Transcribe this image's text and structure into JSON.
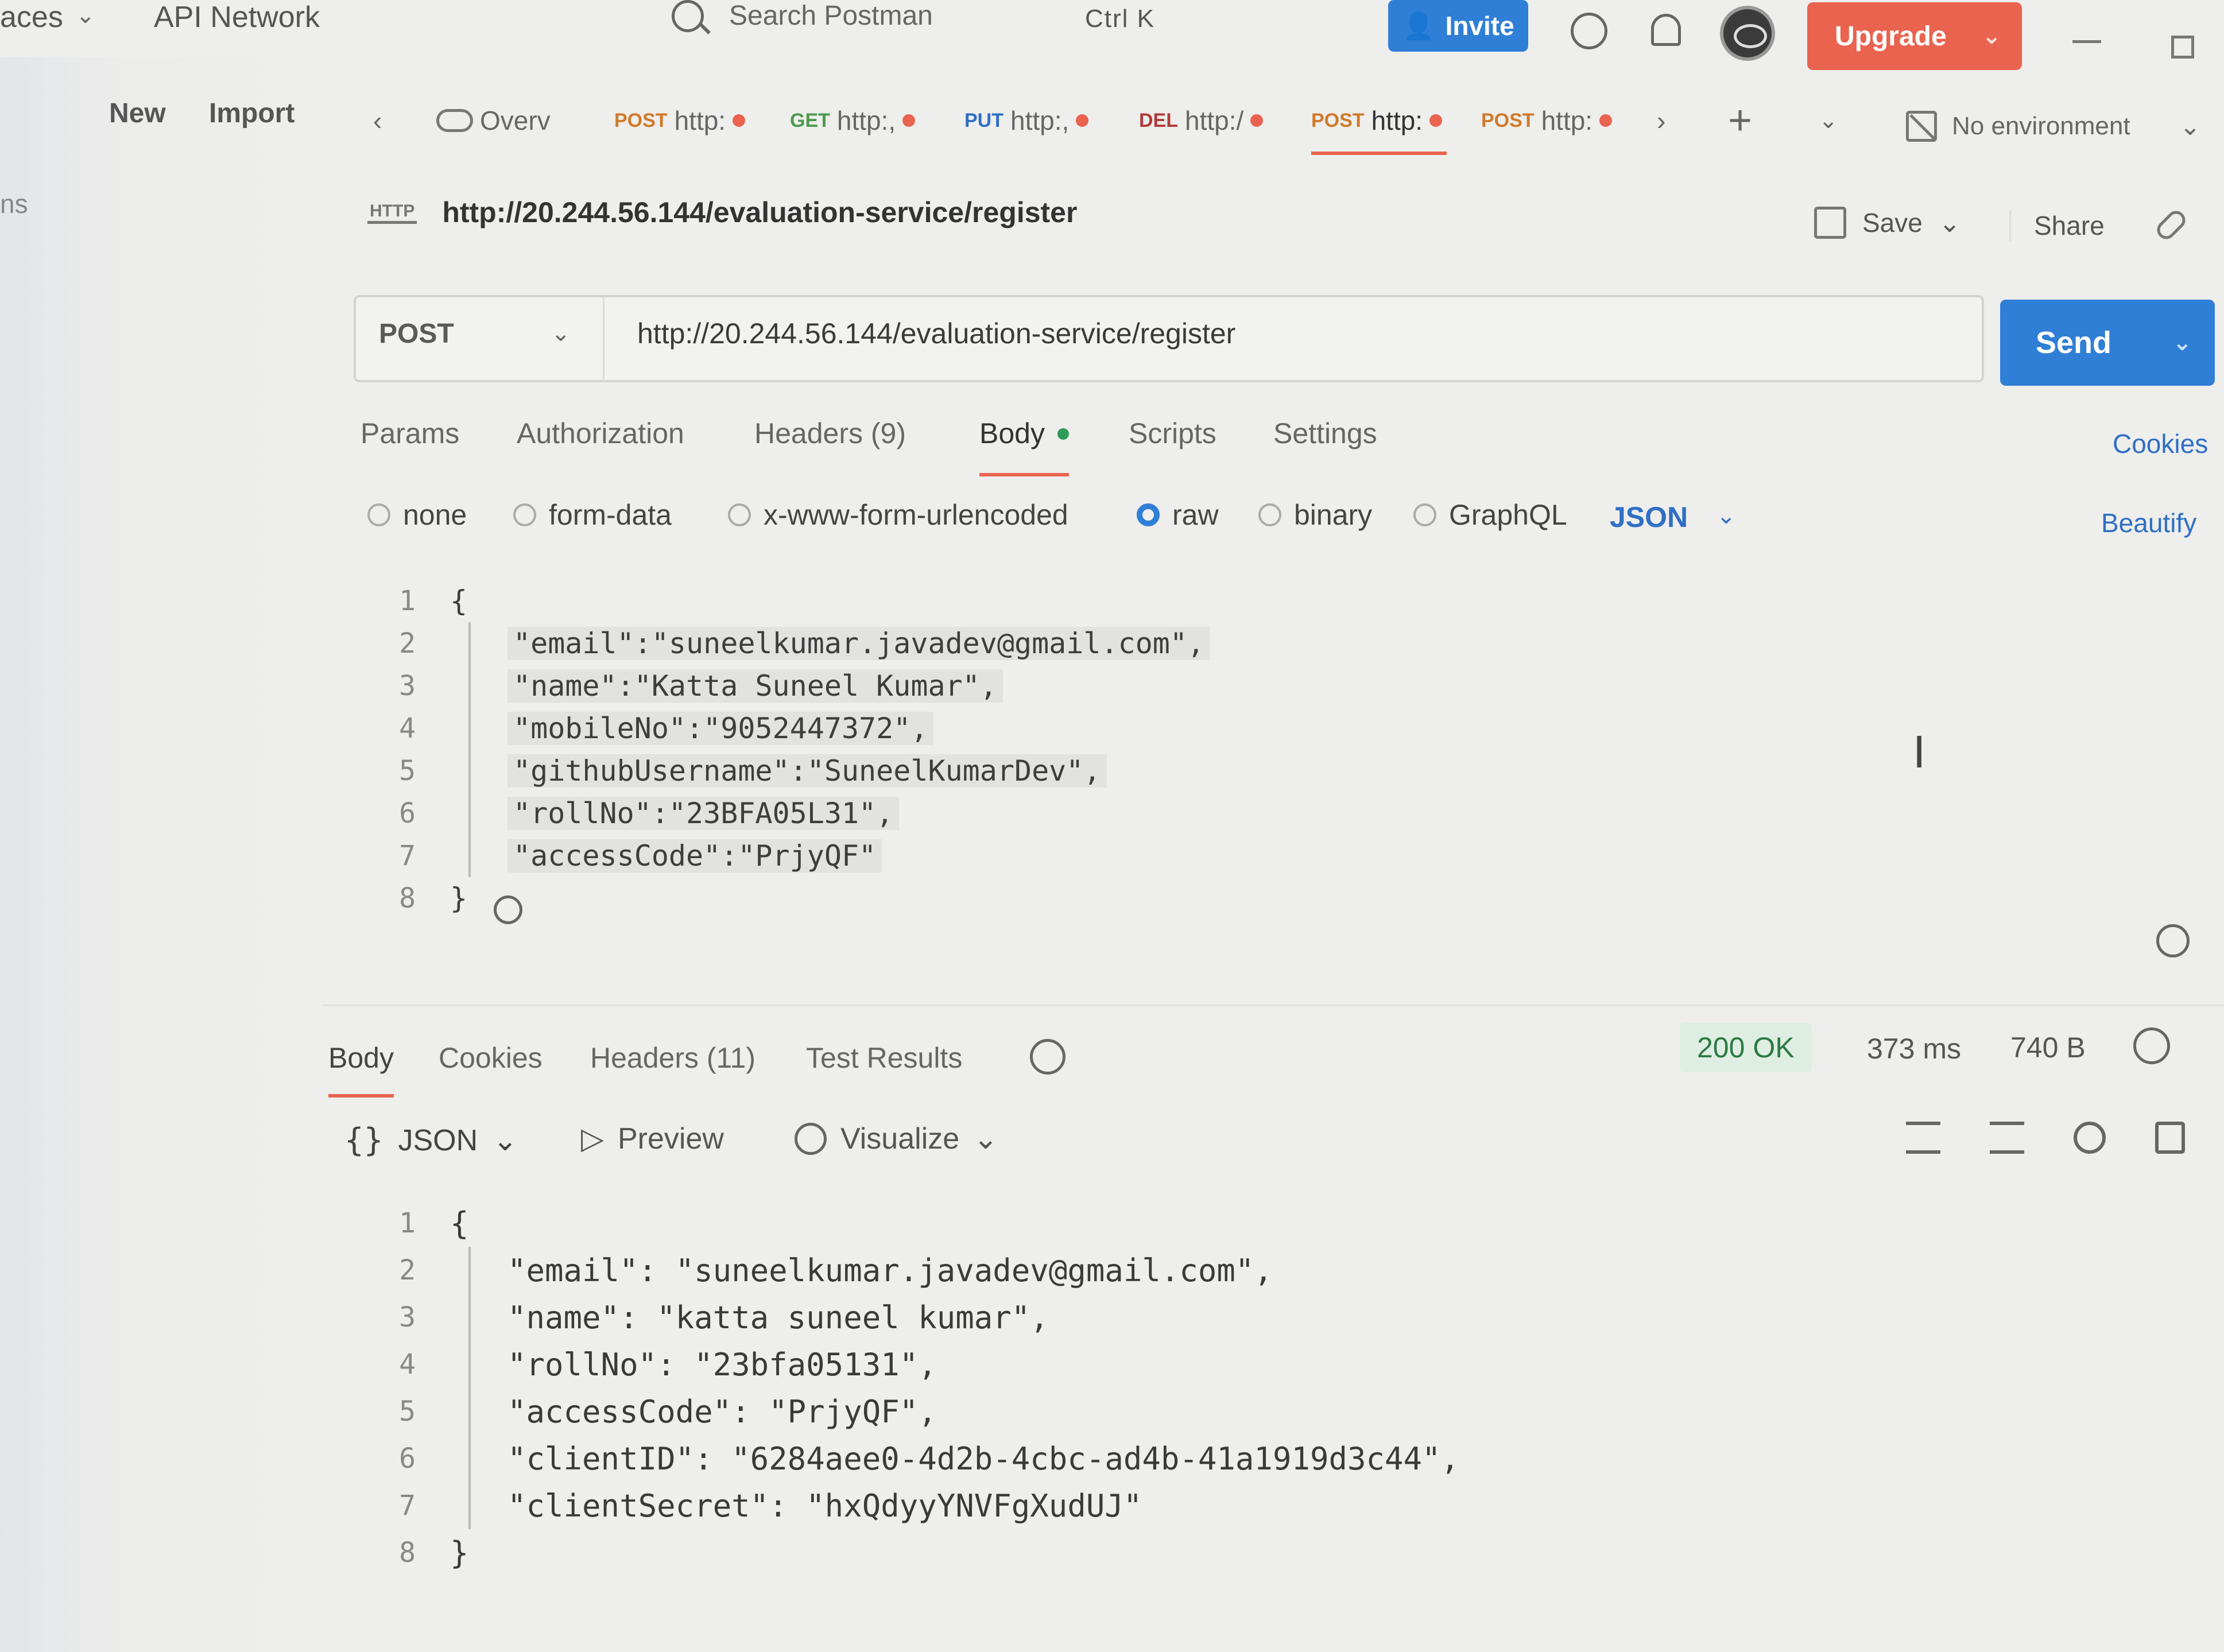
{
  "topbar": {
    "workspaces_label": "aces",
    "network_label": "API Network",
    "search_placeholder": "Search Postman",
    "search_shortcut": "Ctrl  K",
    "invite_label": "Invite",
    "upgrade_label": "Upgrade"
  },
  "sidebar": {
    "new_label": "New",
    "import_label": "Import",
    "fragment_label": "ns"
  },
  "tabs": {
    "overview_label": "Overv",
    "items": [
      {
        "method": "POST",
        "label": "http:"
      },
      {
        "method": "GET",
        "label": "http:,"
      },
      {
        "method": "PUT",
        "label": "http:,"
      },
      {
        "method": "DEL",
        "label": "http:/"
      },
      {
        "method": "POST",
        "label": "http:"
      },
      {
        "method": "POST",
        "label": "http:"
      }
    ],
    "environment_label": "No environment"
  },
  "request": {
    "title_badge": "HTTP",
    "title_url": "http://20.244.56.144/evaluation-service/register",
    "save_label": "Save",
    "share_label": "Share",
    "method": "POST",
    "url": "http://20.244.56.144/evaluation-service/register",
    "send_label": "Send",
    "tabs": {
      "params": "Params",
      "authorization": "Authorization",
      "headers": "Headers (9)",
      "body": "Body",
      "scripts": "Scripts",
      "settings": "Settings"
    },
    "cookies_label": "Cookies",
    "body_types": {
      "none": "none",
      "form_data": "form-data",
      "urlencoded": "x-www-form-urlencoded",
      "raw": "raw",
      "binary": "binary",
      "graphql": "GraphQL",
      "language": "JSON"
    },
    "beautify_label": "Beautify",
    "body_lines": [
      {
        "n": "1",
        "text": "{"
      },
      {
        "n": "2",
        "text": "\"email\":\"suneelkumar.javadev@gmail.com\","
      },
      {
        "n": "3",
        "text": "\"name\":\"Katta Suneel Kumar\","
      },
      {
        "n": "4",
        "text": "\"mobileNo\":\"9052447372\","
      },
      {
        "n": "5",
        "text": "\"githubUsername\":\"SuneelKumarDev\","
      },
      {
        "n": "6",
        "text": "\"rollNo\":\"23BFA05L31\","
      },
      {
        "n": "7",
        "text": "\"accessCode\":\"PrjyQF\""
      },
      {
        "n": "8",
        "text": "}"
      }
    ]
  },
  "response": {
    "tabs": {
      "body": "Body",
      "cookies": "Cookies",
      "headers": "Headers (11)",
      "tests": "Test Results"
    },
    "status": "200 OK",
    "time": "373 ms",
    "size": "740 B",
    "format": "JSON",
    "preview_label": "Preview",
    "visualize_label": "Visualize",
    "body_lines": [
      {
        "n": "1",
        "text": "{"
      },
      {
        "n": "2",
        "text": "\"email\": \"suneelkumar.javadev@gmail.com\","
      },
      {
        "n": "3",
        "text": "\"name\": \"katta suneel kumar\","
      },
      {
        "n": "4",
        "text": "\"rollNo\": \"23bfa05131\","
      },
      {
        "n": "5",
        "text": "\"accessCode\": \"PrjyQF\","
      },
      {
        "n": "6",
        "text": "\"clientID\": \"6284aee0-4d2b-4cbc-ad4b-41a1919d3c44\","
      },
      {
        "n": "7",
        "text": "\"clientSecret\": \"hxQdyyYNVFgXudUJ\""
      },
      {
        "n": "8",
        "text": "}"
      }
    ]
  },
  "colors": {
    "accent_orange": "#e9634f",
    "send_blue": "#2f7fd6",
    "link_blue": "#2f6fc4",
    "status_green": "#2a7a44"
  },
  "icons": [
    "search-icon",
    "invite-user-icon",
    "gear-icon",
    "bell-icon",
    "avatar-icon",
    "cloud-icon",
    "environment-icon",
    "save-icon",
    "link-icon",
    "history-icon",
    "globe-icon",
    "wrap-icon",
    "filter-icon",
    "copy-icon",
    "visualize-icon",
    "text-cursor-icon",
    "ai-assist-icon"
  ]
}
